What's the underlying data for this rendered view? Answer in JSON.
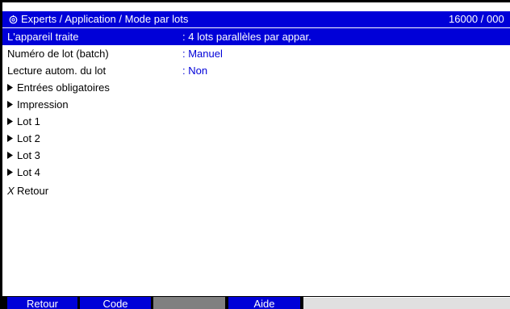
{
  "header": {
    "icon": "gear-icon",
    "title": "Experts / Application / Mode par lots",
    "counter": "16000 / 000"
  },
  "rows": [
    {
      "label": "L'appareil traite",
      "value": ": 4 lots parallèles par appar."
    },
    {
      "label": "Numéro de lot (batch)",
      "value": ": Manuel"
    },
    {
      "label": "Lecture autom. du lot",
      "value": ": Non"
    }
  ],
  "menu_items": [
    {
      "label": "Entrées obligatoires",
      "icon": "arrow-right-icon"
    },
    {
      "label": "Impression",
      "icon": "arrow-right-icon"
    },
    {
      "label": "Lot 1",
      "icon": "arrow-right-icon"
    },
    {
      "label": "Lot 2",
      "icon": "arrow-right-icon"
    },
    {
      "label": "Lot 3",
      "icon": "arrow-right-icon"
    },
    {
      "label": "Lot 4",
      "icon": "arrow-right-icon"
    }
  ],
  "back_item": {
    "label": "Retour",
    "icon": "x-icon",
    "glyph": "X"
  },
  "softkeys": [
    {
      "label": "Retour"
    },
    {
      "label": "Code"
    },
    {
      "label": ""
    },
    {
      "label": "Aide"
    }
  ],
  "colors": {
    "selection": "#0000d8",
    "value_blue": "#0000d8",
    "softkey_disabled": "#808080"
  }
}
